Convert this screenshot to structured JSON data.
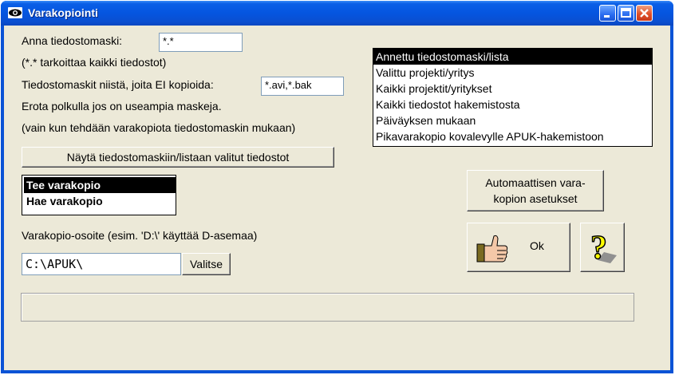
{
  "window": {
    "title": "Varakopiointi"
  },
  "mask": {
    "label": "Anna tiedostomaski:",
    "value": "*.*",
    "hint": "(*.* tarkoittaa kaikki tiedostot)",
    "exclude_label": "Tiedostomaskit niistä, joita EI kopioida:",
    "exclude_value": "*.avi,*.bak",
    "sep_hint": "Erota polkulla jos on useampia maskeja.",
    "only_hint": "(vain kun tehdään varakopiota tiedostomaskin mukaan)"
  },
  "show_files_button": "Näytä tiedostomaskiin/listaan valitut tiedostot",
  "source_list": {
    "items": [
      "Annettu tiedostomaski/lista",
      "Valittu projekti/yritys",
      "Kaikki projektit/yritykset",
      "Kaikki tiedostot hakemistosta",
      "Päiväyksen mukaan",
      "Pikavarakopio kovalevylle APUK-hakemistoon"
    ],
    "selected_index": 0
  },
  "mode_list": {
    "items": [
      "Tee varakopio",
      "Hae varakopio"
    ],
    "selected_index": 0
  },
  "auto_settings_button": {
    "line1": "Automaattisen vara-",
    "line2": "kopion asetukset"
  },
  "ok_button": {
    "label": "Ok"
  },
  "path": {
    "label": "Varakopio-osoite (esim. 'D:\\' käyttää D-asemaa)",
    "value": "C:\\APUK\\",
    "browse_label": "Valitse"
  },
  "colors": {
    "selection": "#000000",
    "face": "#ece9d8",
    "titlebar": "#0555e0"
  }
}
